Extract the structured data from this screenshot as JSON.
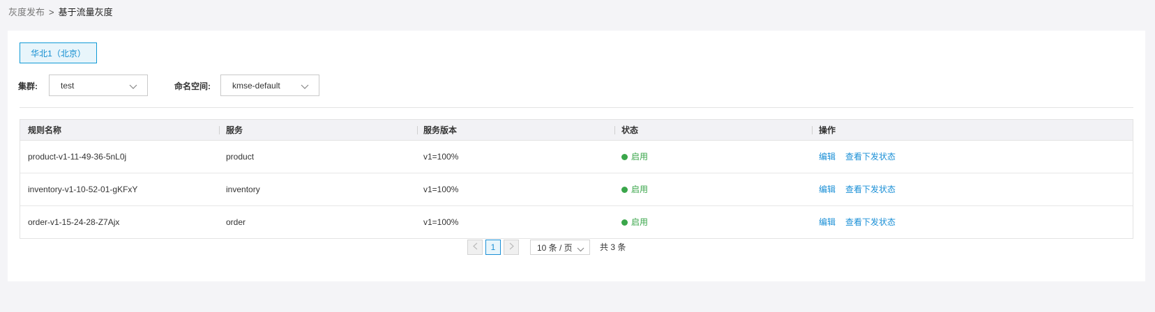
{
  "breadcrumb": {
    "parent": "灰度发布",
    "separator": ">",
    "current": "基于流量灰度"
  },
  "region_tab": {
    "label": "华北1（北京）"
  },
  "filters": {
    "cluster_label": "集群:",
    "cluster_value": "test",
    "namespace_label": "命名空间:",
    "namespace_value": "kmse-default"
  },
  "table": {
    "headers": [
      "规则名称",
      "服务",
      "服务版本",
      "状态",
      "操作"
    ],
    "rows": [
      {
        "name": "product-v1-11-49-36-5nL0j",
        "service": "product",
        "version": "v1=100%",
        "status": "启用"
      },
      {
        "name": "inventory-v1-10-52-01-gKFxY",
        "service": "inventory",
        "version": "v1=100%",
        "status": "启用"
      },
      {
        "name": "order-v1-15-24-28-Z7Ajx",
        "service": "order",
        "version": "v1=100%",
        "status": "启用"
      }
    ],
    "actions": {
      "edit": "编辑",
      "view_status": "查看下发状态"
    }
  },
  "pagination": {
    "current_page": "1",
    "page_size": "10 条 / 页",
    "total": "共 3 条"
  },
  "colors": {
    "accent": "#1a8fd6",
    "status_enabled": "#3aa64a",
    "background": "#f4f4f7"
  }
}
